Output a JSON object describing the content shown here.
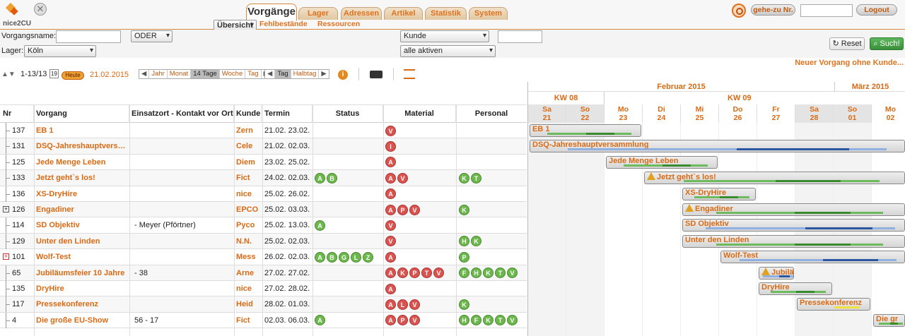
{
  "brand": {
    "logo_text": "nice2CU"
  },
  "tabs": [
    {
      "label": "Vorgänge",
      "active": true
    },
    {
      "label": "Lager"
    },
    {
      "label": "Adressen"
    },
    {
      "label": "Artikel"
    },
    {
      "label": "Statistik"
    },
    {
      "label": "System"
    }
  ],
  "subnav": [
    "Übersicht",
    "Fehlbestände",
    "Ressourcen"
  ],
  "topright": {
    "goto_label": "gehe-zu Nr.",
    "goto_value": "",
    "logout_label": "Logout"
  },
  "filters": {
    "vorgangsname_label": "Vorgangsname:",
    "vorgangsname_value": "",
    "oder": "ODER",
    "lager_label": "Lager:",
    "lager_value": "Köln",
    "kunde_select": "Kunde",
    "kunde_value": "",
    "status_select": "alle aktiven",
    "reset_label": "Reset",
    "suche_label": "Such!"
  },
  "new_link": "Neuer Vorgang ohne Kunde...",
  "toolbar": {
    "range": "1-13/13",
    "cal_day": "19",
    "heute": "Heute",
    "date": "21.02.2015",
    "zoom": [
      "Jahr",
      "Monat",
      "14 Tage",
      "Woche",
      "Tag"
    ],
    "zoom_active": "14 Tage",
    "unit": [
      "Tag",
      "Halbtag"
    ],
    "unit_active": "Tag"
  },
  "columns": [
    "Nr",
    "Vorgang",
    "Einsatzort - Kontakt vor Ort",
    "Kunde",
    "Termin",
    "Status",
    "Material",
    "Personal"
  ],
  "rows": [
    {
      "nr": "137",
      "name": "EB 1",
      "ort": "",
      "kunde": "Zern",
      "termin": "21.02. 23.02.",
      "status": [],
      "material": [
        "V"
      ],
      "personal": [],
      "tree": ""
    },
    {
      "nr": "131",
      "name": "DSQ-Jahreshauptvers…",
      "ort": "",
      "kunde": "Cele",
      "termin": "21.02. 02.03.",
      "status": [],
      "material": [
        "I"
      ],
      "personal": [],
      "tree": ""
    },
    {
      "nr": "125",
      "name": "Jede Menge Leben",
      "ort": "",
      "kunde": "Diem",
      "termin": "23.02. 25.02.",
      "status": [],
      "material": [
        "A"
      ],
      "personal": [],
      "tree": ""
    },
    {
      "nr": "133",
      "name": "Jetzt geht`s los!",
      "ort": "",
      "kunde": "Fict",
      "termin": "24.02. 02.03.",
      "status": [
        "A",
        "B"
      ],
      "material": [
        "A",
        "V"
      ],
      "personal": [
        "K",
        "T"
      ],
      "tree": ""
    },
    {
      "nr": "136",
      "name": "XS-DryHire",
      "ort": "",
      "kunde": "nice",
      "termin": "25.02. 26.02.",
      "status": [],
      "material": [
        "A"
      ],
      "personal": [],
      "tree": ""
    },
    {
      "nr": "126",
      "name": "Engadiner",
      "ort": "",
      "kunde": "EPCO",
      "termin": "25.02. 03.03.",
      "status": [],
      "material": [
        "A",
        "P",
        "V"
      ],
      "personal": [
        "K"
      ],
      "tree": "plus"
    },
    {
      "nr": "114",
      "name": "SD Objektiv",
      "ort": "- Meyer (Pförtner)",
      "kunde": "Pyco",
      "termin": "25.02. 13.03.",
      "status": [
        "A"
      ],
      "material": [
        "V"
      ],
      "personal": [],
      "tree": ""
    },
    {
      "nr": "129",
      "name": "Unter den Linden",
      "ort": "",
      "kunde": "N.N.",
      "termin": "25.02. 02.03.",
      "status": [],
      "material": [
        "V"
      ],
      "personal": [
        "H",
        "K"
      ],
      "tree": ""
    },
    {
      "nr": "101",
      "name": "Wolf-Test",
      "ort": "",
      "kunde": "Mess",
      "termin": "26.02. 02.03.",
      "status": [
        "A",
        "B",
        "G",
        "L",
        "Z"
      ],
      "material": [
        "A"
      ],
      "personal": [
        "P"
      ],
      "tree": "plus-red"
    },
    {
      "nr": "65",
      "name": "Jubiläumsfeier 10 Jahre",
      "ort": "- 38",
      "kunde": "Arne",
      "termin": "27.02. 27.02.",
      "status": [],
      "material": [
        "A",
        "K",
        "P",
        "T",
        "V"
      ],
      "personal": [
        "F",
        "H",
        "K",
        "T",
        "V"
      ],
      "tree": ""
    },
    {
      "nr": "135",
      "name": "DryHire",
      "ort": "",
      "kunde": "nice",
      "termin": "27.02. 28.02.",
      "status": [],
      "material": [
        "A"
      ],
      "personal": [],
      "tree": ""
    },
    {
      "nr": "117",
      "name": "Pressekonferenz",
      "ort": "",
      "kunde": "Heid",
      "termin": "28.02. 01.03.",
      "status": [],
      "material": [
        "A",
        "L",
        "V"
      ],
      "personal": [
        "K"
      ],
      "tree": ""
    },
    {
      "nr": "4",
      "name": "Die große EU-Show",
      "ort": "56 - 17",
      "kunde": "Fict",
      "termin": "02.03. 06.03.",
      "status": [
        "A"
      ],
      "material": [
        "A",
        "P",
        "V"
      ],
      "personal": [
        "H",
        "F",
        "K",
        "T",
        "V"
      ],
      "tree": ""
    }
  ],
  "gantt": {
    "months": [
      "Februar 2015",
      "März 2015"
    ],
    "weeks": [
      "KW 08",
      "KW 09"
    ],
    "days": [
      {
        "wd": "Sa",
        "d": "21",
        "we": true
      },
      {
        "wd": "So",
        "d": "22",
        "we": true
      },
      {
        "wd": "Mo",
        "d": "23"
      },
      {
        "wd": "Di",
        "d": "24"
      },
      {
        "wd": "Mi",
        "d": "25"
      },
      {
        "wd": "Do",
        "d": "26"
      },
      {
        "wd": "Fr",
        "d": "27"
      },
      {
        "wd": "Sa",
        "d": "28",
        "we": true
      },
      {
        "wd": "So",
        "d": "01",
        "we": true
      },
      {
        "wd": "Mo",
        "d": "02"
      }
    ],
    "bars": [
      {
        "label": "EB 1",
        "start": 0,
        "len": 3,
        "warn": false
      },
      {
        "label": "DSQ-Jahreshauptversammlung",
        "start": 0,
        "len": 10,
        "warn": false
      },
      {
        "label": "Jede Menge Leben",
        "start": 2,
        "len": 3,
        "warn": false
      },
      {
        "label": "Jetzt geht`s los!",
        "start": 3,
        "len": 7,
        "warn": true
      },
      {
        "label": "XS-DryHire",
        "start": 4,
        "len": 2,
        "warn": false
      },
      {
        "label": "Engadiner",
        "start": 4,
        "len": 6,
        "warn": true
      },
      {
        "label": "SD Objektiv",
        "start": 4,
        "len": 6,
        "warn": false
      },
      {
        "label": "Unter den Linden",
        "start": 4,
        "len": 6,
        "warn": false
      },
      {
        "label": "Wolf-Test",
        "start": 5,
        "len": 5,
        "warn": false
      },
      {
        "label": "Jubiläu",
        "start": 6,
        "len": 1,
        "warn": true
      },
      {
        "label": "DryHire",
        "start": 6,
        "len": 2,
        "warn": false
      },
      {
        "label": "Pressekonferenz",
        "start": 7,
        "len": 2,
        "warn": false
      },
      {
        "label": "Die gr",
        "start": 9,
        "len": 1,
        "warn": false
      }
    ]
  }
}
